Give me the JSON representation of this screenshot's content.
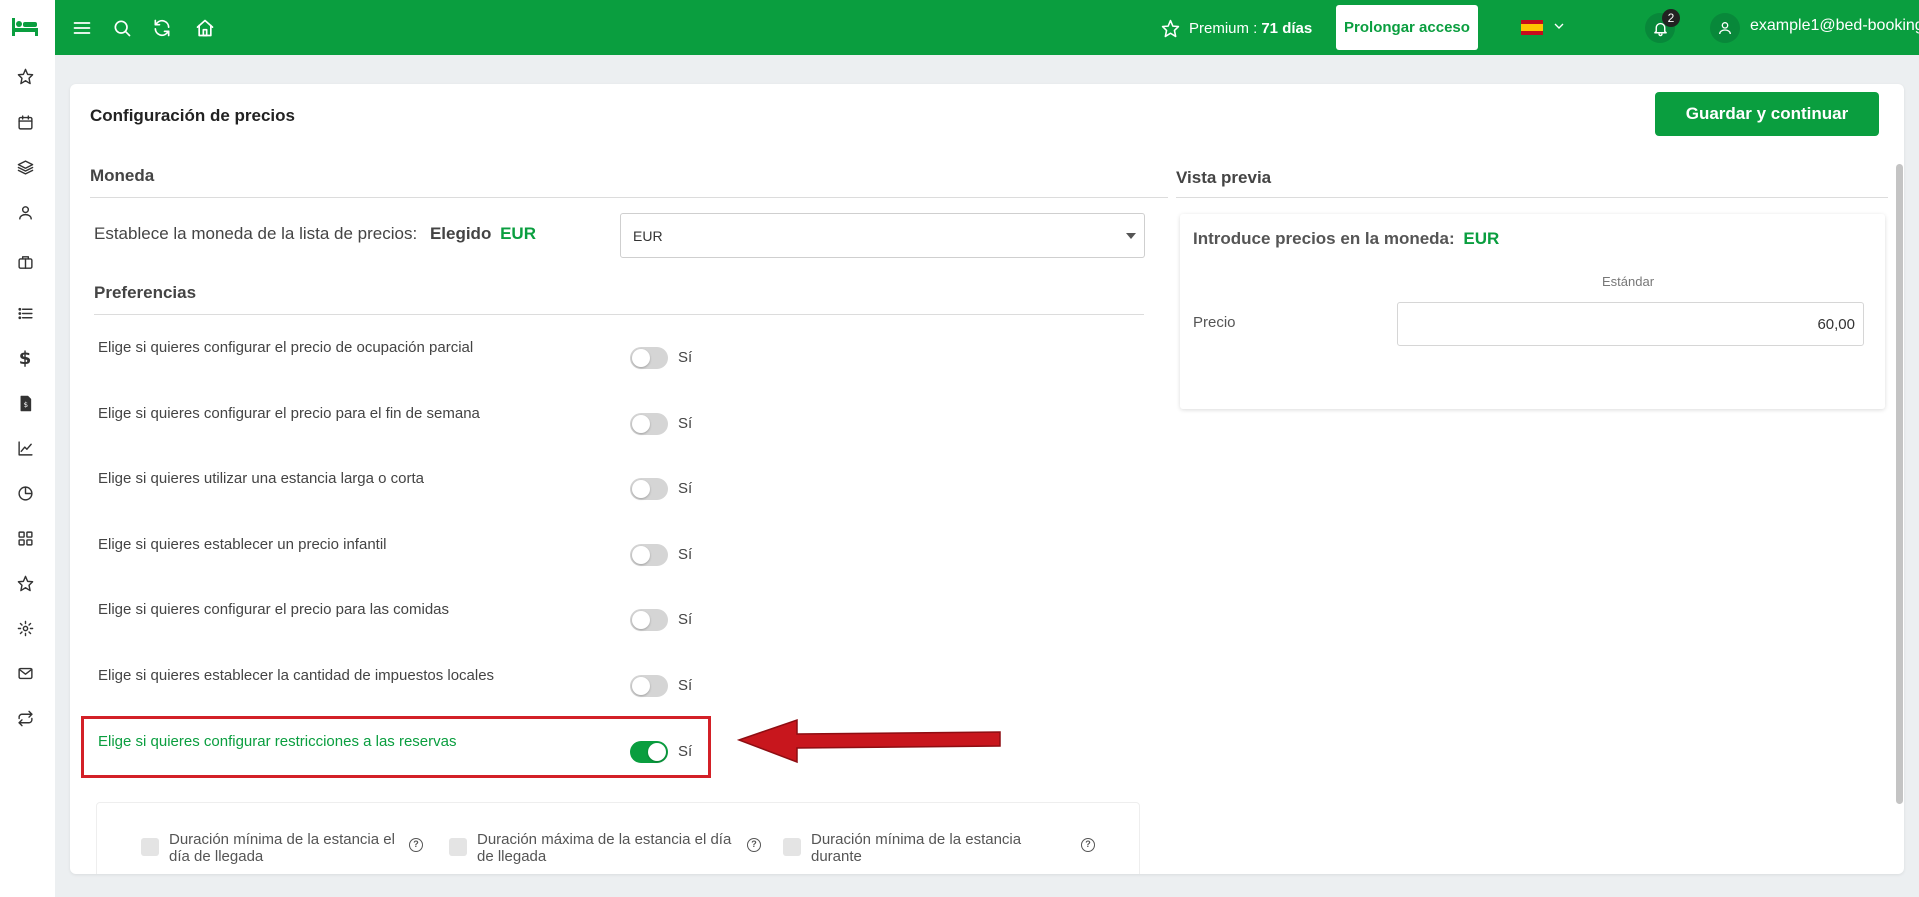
{
  "topbar": {
    "premium_label": "Premium :",
    "premium_days": "71 días",
    "extend_button": "Prolongar acceso",
    "notifications_count": "2",
    "user_email": "example1@bed-booking.com",
    "brand_color": "#0a9e3f"
  },
  "sidebar": {
    "icons": [
      "bed-logo",
      "star-icon",
      "calendar-icon",
      "layers-icon",
      "user-icon",
      "briefcase-icon",
      "list-icon",
      "dollar-icon",
      "invoice-icon",
      "chart-icon",
      "pie-icon",
      "grid-icon",
      "star-icon",
      "gear-icon",
      "mail-icon",
      "sync-icon"
    ]
  },
  "page": {
    "title": "Configuración de precios",
    "save_button": "Guardar y continuar"
  },
  "currency": {
    "section_title": "Moneda",
    "label": "Establece la moneda de la lista de precios:",
    "chosen_label": "Elegido",
    "chosen_value": "EUR",
    "select_value": "EUR"
  },
  "preferences": {
    "section_title": "Preferencias",
    "toggle_label": "Sí",
    "items": [
      {
        "label": "Elige si quieres configurar el precio de ocupación parcial",
        "on": false
      },
      {
        "label": "Elige si quieres configurar el precio para el fin de semana",
        "on": false
      },
      {
        "label": "Elige si quieres utilizar una estancia larga o corta",
        "on": false
      },
      {
        "label": "Elige si quieres establecer un precio infantil",
        "on": false
      },
      {
        "label": "Elige si quieres configurar el precio para las comidas",
        "on": false
      },
      {
        "label": "Elige si quieres establecer la cantidad de impuestos locales",
        "on": false
      },
      {
        "label": "Elige si quieres configurar restricciones a las reservas",
        "on": true
      }
    ]
  },
  "restrictions": {
    "items": [
      "Duración mínima de la estancia el día de llegada",
      "Duración máxima de la estancia el día de llegada",
      "Duración mínima de la estancia durante"
    ]
  },
  "preview": {
    "section_title": "Vista previa",
    "heading": "Introduce precios en la moneda:",
    "currency": "EUR",
    "column": "Estándar",
    "price_label": "Precio",
    "price_value": "60,00"
  }
}
